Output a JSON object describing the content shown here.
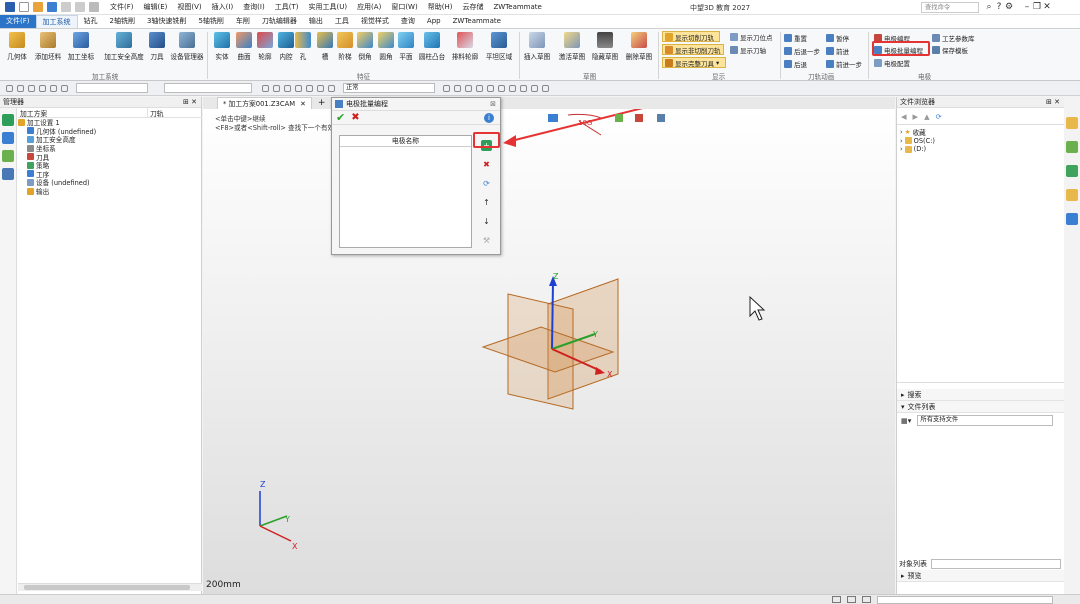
{
  "title_bar": {
    "menus": [
      "文件(F)",
      "编辑(E)",
      "视图(V)",
      "插入(I)",
      "查询(I)",
      "工具(T)",
      "实用工具(U)",
      "应用(A)",
      "窗口(W)",
      "帮助(H)",
      "云存储",
      "ZWTeammate"
    ],
    "app_title": "中望3D 教育 2027",
    "search_placeholder": "查找命令"
  },
  "ribbon": {
    "tabs": [
      "文件(F)",
      "加工系统",
      "钻孔",
      "2轴铣削",
      "3轴快速铣削",
      "5轴铣削",
      "车削",
      "刀轨编辑器",
      "输出",
      "工具",
      "视觉样式",
      "查询",
      "App",
      "ZWTeammate"
    ],
    "active_tab": "加工系统",
    "groups": {
      "machining_system": {
        "label": "加工系统",
        "buttons": [
          "几何体",
          "添加坯料",
          "加工坐标",
          "加工安全高度",
          "刀具",
          "设备管理器"
        ]
      },
      "feature": {
        "label": "特征",
        "buttons": [
          "实体",
          "曲面",
          "轮廓",
          "内腔",
          "孔",
          "槽",
          "阶梯",
          "倒角",
          "圆角",
          "平面",
          "圆柱凸台",
          "排料轮廓",
          "平坦区域"
        ]
      },
      "sketch": {
        "label": "草图",
        "buttons": [
          "插入草图",
          "激活草图",
          "隐藏草图",
          "删除草图"
        ]
      },
      "display": {
        "label": "显示",
        "items": [
          "显示切削刀轨",
          "显示非切削刀轨",
          "显示完整刀具",
          "显示刀位点",
          "显示刀轴"
        ]
      },
      "toolpath_anim": {
        "label": "刀轨动画",
        "items": [
          "重置",
          "暂停",
          "后退一步",
          "前进",
          "后退",
          "前进一步"
        ]
      },
      "electrode": {
        "label": "电极",
        "items": [
          "电极编程",
          "工艺参数库",
          "电极批量编程",
          "保存模板",
          "电极配置"
        ]
      }
    }
  },
  "toolbar": {
    "display_mode": "正常"
  },
  "manager": {
    "title": "管理器",
    "columns": [
      "加工方案",
      "刀轨"
    ],
    "tree": [
      {
        "label": "加工设置 1",
        "level": 0
      },
      {
        "label": "几何体 (undefined)",
        "level": 1
      },
      {
        "label": "加工安全高度",
        "level": 1
      },
      {
        "label": "坐标系",
        "level": 1
      },
      {
        "label": "刀具",
        "level": 1
      },
      {
        "label": "策略",
        "level": 1
      },
      {
        "label": "工序",
        "level": 1
      },
      {
        "label": "设备 (undefined)",
        "level": 1
      },
      {
        "label": "输出",
        "level": 1
      }
    ]
  },
  "document": {
    "tab_label": "* 加工方案001.Z3CAM",
    "hints": [
      "<单击中键>继续",
      "<F8>或者<Shift-roll> 查找下一个有效的"
    ],
    "scale": "200mm",
    "sketch_note": "10G",
    "axes": {
      "x": "X",
      "y": "Y",
      "z": "Z"
    }
  },
  "dialog": {
    "title": "电极批量编程",
    "list_header": "电极名称"
  },
  "file_browser": {
    "title": "文件浏览器",
    "tree": [
      "收藏",
      "OS(C:)",
      "(D:)"
    ],
    "sections": {
      "search": "搜索",
      "file_list": "文件列表",
      "object_list": "对象列表",
      "preview": "预览"
    },
    "filter": "所有支持文件"
  }
}
